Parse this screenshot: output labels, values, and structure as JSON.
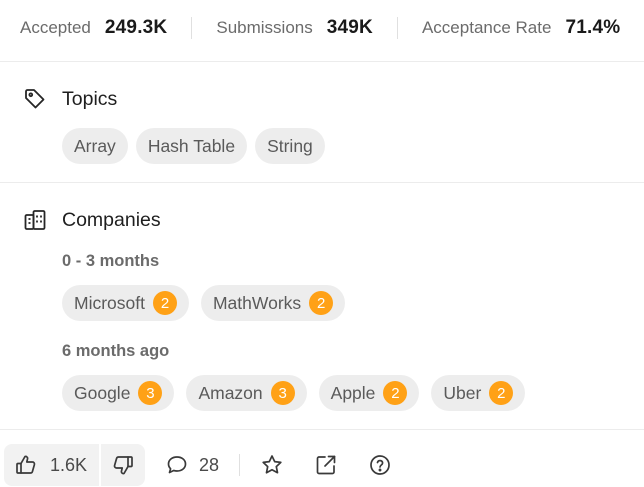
{
  "stats": {
    "accepted_label": "Accepted",
    "accepted_value": "249.3K",
    "submissions_label": "Submissions",
    "submissions_value": "349K",
    "acceptance_label": "Acceptance Rate",
    "acceptance_value": "71.4%"
  },
  "topics": {
    "title": "Topics",
    "icon": "tag-icon",
    "tags": [
      "Array",
      "Hash Table",
      "String"
    ]
  },
  "companies": {
    "title": "Companies",
    "icon": "building-icon",
    "groups": [
      {
        "period": "0 - 3 months",
        "items": [
          {
            "name": "Microsoft",
            "count": "2"
          },
          {
            "name": "MathWorks",
            "count": "2"
          }
        ]
      },
      {
        "period": "6 months ago",
        "items": [
          {
            "name": "Google",
            "count": "3"
          },
          {
            "name": "Amazon",
            "count": "3"
          },
          {
            "name": "Apple",
            "count": "2"
          },
          {
            "name": "Uber",
            "count": "2"
          }
        ]
      }
    ]
  },
  "footer": {
    "likes": "1.6K",
    "comments": "28",
    "icons": [
      "thumbs-up-icon",
      "thumbs-down-icon",
      "comment-icon",
      "star-icon",
      "external-link-icon",
      "help-icon"
    ]
  },
  "colors": {
    "badge": "#ffa116",
    "chip_bg": "#ededed",
    "divider": "#ececec"
  }
}
